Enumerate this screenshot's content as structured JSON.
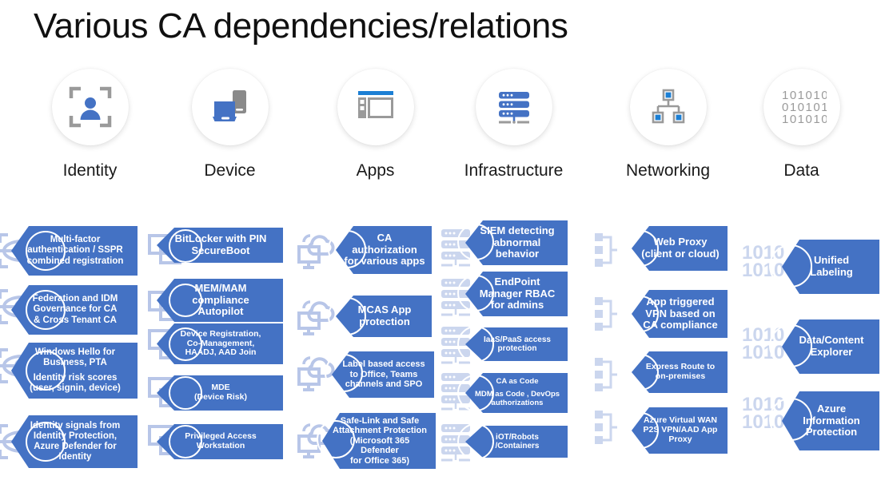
{
  "title": "Various CA dependencies/relations",
  "theme": {
    "card_blue": "#4472C4",
    "icon_blue": "#4472C4",
    "icon_gray": "#9A9A9A",
    "watermark_blue": "#B8C6E8",
    "circle_bg": "#FFFFFF",
    "page_bg": "#FFFFFF",
    "title_color": "#101010"
  },
  "columns": [
    {
      "id": "identity",
      "label": "Identity",
      "icon": "person-viewfinder-icon",
      "watermark": "eye-scan-icon",
      "cards": [
        {
          "lines": [
            "Multi-factor",
            "authentication / SSPR",
            "combined registration"
          ]
        },
        {
          "lines": [
            "Federation and IDM",
            "Governance for CA",
            "& Cross Tenant CA"
          ]
        },
        {
          "lines": [
            "Windows Hello for",
            "Business, PTA",
            "",
            "Identity risk scores",
            "(user, signin, device)"
          ]
        },
        {
          "lines": [
            "Identity signals from",
            "Identity Protection,",
            "Azure Defender for",
            "Identity"
          ]
        }
      ]
    },
    {
      "id": "device",
      "label": "Device",
      "icon": "laptop-phone-icon",
      "watermark": "devices-wireless-icon",
      "cards": [
        {
          "lines": [
            "BitLocker with PIN",
            "SecureBoot"
          ]
        },
        {
          "lines": [
            "MEM/MAM",
            "compliance",
            "Autopilot"
          ]
        },
        {
          "lines": [
            "Device Registration,",
            "Co-Management,",
            "HAADJ, AAD Join"
          ]
        },
        {
          "lines": [
            "MDE",
            "(Device Risk)"
          ]
        },
        {
          "lines": [
            "Privileged Access",
            "Workstation"
          ]
        }
      ]
    },
    {
      "id": "apps",
      "label": "Apps",
      "icon": "app-window-icon",
      "watermark": "cloud-monitor-icon",
      "cards": [
        {
          "lines": [
            "CA",
            "authorization",
            "for various apps"
          ]
        },
        {
          "lines": [
            "MCAS App",
            "protection"
          ]
        },
        {
          "lines": [
            "Label based access",
            "to Office, Teams",
            "channels and SPO"
          ]
        },
        {
          "lines": [
            "Safe-Link and Safe",
            "Attachment Protection",
            "(Microsoft 365 Defender",
            "for Office 365)"
          ]
        }
      ]
    },
    {
      "id": "infrastructure",
      "label": "Infrastructure",
      "icon": "server-rack-icon",
      "watermark": "server-rack-icon",
      "cards": [
        {
          "lines": [
            "SIEM detecting",
            "abnormal",
            "behavior"
          ]
        },
        {
          "lines": [
            "EndPoint",
            "Manager RBAC",
            "for admins"
          ]
        },
        {
          "lines": [
            "IaaS/PaaS access",
            "protection"
          ]
        },
        {
          "lines": [
            "CA as Code",
            "",
            "MDM as Code , DevOps",
            "authorizations"
          ]
        },
        {
          "lines": [
            "iOT/Robots /Containers"
          ]
        }
      ]
    },
    {
      "id": "networking",
      "label": "Networking",
      "icon": "network-topology-icon",
      "watermark": "network-topology-icon",
      "cards": [
        {
          "lines": [
            "Web Proxy",
            "(client or cloud)"
          ]
        },
        {
          "lines": [
            "App triggered",
            "VPN based on",
            "CA compliance"
          ]
        },
        {
          "lines": [
            "Express Route to",
            "on-premises"
          ]
        },
        {
          "lines": [
            "Azure Virtual WAN",
            "P2S VPN/AAD App",
            "Proxy"
          ]
        }
      ]
    },
    {
      "id": "data",
      "label": "Data",
      "icon": "binary-code-icon",
      "watermark": "binary-code-icon",
      "cards": [
        {
          "lines": [
            "Unified",
            "Labeling"
          ]
        },
        {
          "lines": [
            "Data/Content",
            "Explorer"
          ]
        },
        {
          "lines": [
            "Azure",
            "Information",
            "Protection"
          ]
        }
      ]
    }
  ]
}
